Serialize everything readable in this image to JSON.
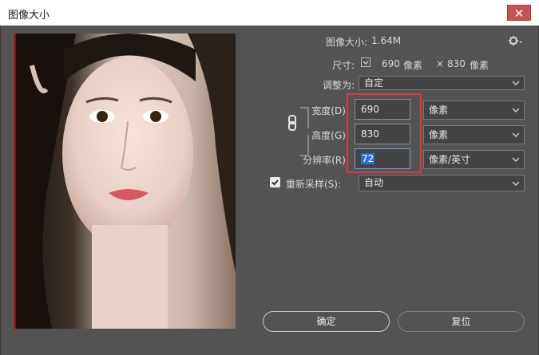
{
  "window": {
    "title": "图像大小"
  },
  "icons": {
    "close": "close-icon",
    "gear": "gear-icon",
    "link": "link-chain-icon",
    "check": "checkmark-icon"
  },
  "image_size": {
    "label": "图像大小:",
    "value": "1.64M"
  },
  "dimensions": {
    "label": "尺寸:",
    "width": "690",
    "unit_w": "像素",
    "times": "×",
    "height": "830",
    "unit_h": "像素"
  },
  "fit_to": {
    "label": "调整为:",
    "selected": "自定"
  },
  "width": {
    "label": "宽度(D):",
    "value": "690",
    "unit": "像素"
  },
  "height": {
    "label": "高度(G):",
    "value": "830",
    "unit": "像素"
  },
  "resolution": {
    "label": "分辨率(R):",
    "value": "72",
    "unit": "像素/英寸"
  },
  "resample": {
    "checked": true,
    "label": "重新采样(S):",
    "selected": "自动"
  },
  "buttons": {
    "ok": "确定",
    "reset": "复位"
  },
  "colors": {
    "highlight": "#e23737",
    "selection": "#2f6fd6"
  }
}
